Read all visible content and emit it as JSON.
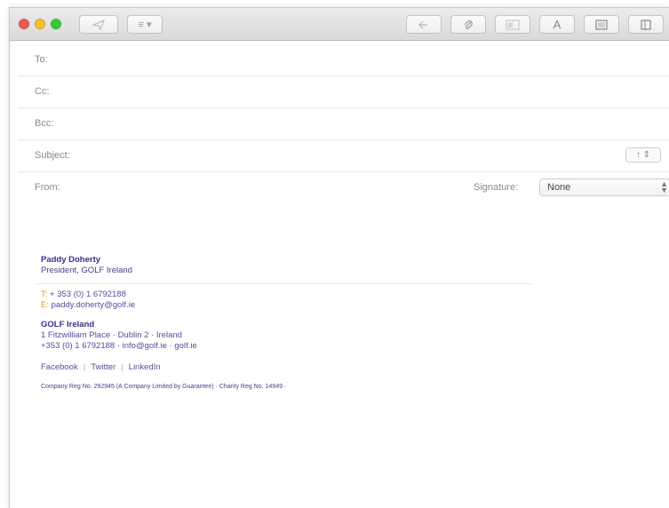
{
  "window": {
    "traffic_lights": {
      "close": "#ee5a52",
      "minimize": "#f5bf2f",
      "zoom": "#3ec640"
    }
  },
  "toolbar": {
    "buttons": [
      {
        "name": "send-button",
        "icon": "paper-plane-icon"
      },
      {
        "name": "header-fields-button",
        "icon": "list-icon",
        "label": "≡ ▾"
      },
      {
        "name": "reply-button",
        "icon": "reply-icon"
      },
      {
        "name": "attach-button",
        "icon": "paperclip-icon"
      },
      {
        "name": "format-button",
        "icon": "format-icon"
      },
      {
        "name": "font-button",
        "icon": "font-icon",
        "label": "A"
      },
      {
        "name": "photo-browser-button",
        "icon": "photo-icon"
      },
      {
        "name": "extra-button",
        "icon": "panel-icon"
      }
    ]
  },
  "fields": {
    "to_label": "To:",
    "cc_label": "Cc:",
    "bcc_label": "Bcc:",
    "subject_label": "Subject:",
    "from_label": "From:",
    "signature_label": "Signature:",
    "signature_value": "None",
    "priority_stepper": "↑ ⇕"
  },
  "signature": {
    "name": "Paddy Doherty",
    "role": "President, GOLF Ireland",
    "phone_label": "T:",
    "phone": "+ 353 (0) 1 6792188",
    "email_label": "E:",
    "email": "paddy.doherty@golf.ie",
    "org": "GOLF Ireland",
    "address": "1 Fitzwilliam Place · Dublin 2 · Ireland",
    "org_contact": "+353 (0) 1 6792188 · info@golf.ie · golf.ie",
    "social": [
      "Facebook",
      "Twitter",
      "LinkedIn"
    ],
    "legal": "Company Reg No. 292945 (A Company Limited by Guarantee) · Charity Reg No. 14949 ·"
  }
}
